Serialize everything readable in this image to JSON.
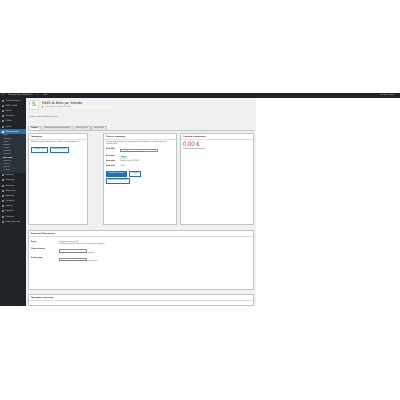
{
  "adminbar": {
    "site": "Ελληνικό Site με WordPress",
    "comments": "0",
    "new": "+ Νέο",
    "greeting": "Γεια σου, admin"
  },
  "sidebar": {
    "items": [
      {
        "label": "Πίνακας Ελέγχου"
      },
      {
        "label": "SMS Σε Web"
      },
      {
        "label": "Άρθρα"
      },
      {
        "label": "Πολυμέσα"
      },
      {
        "label": "Σελίδες"
      },
      {
        "label": "Σχόλια"
      },
      {
        "label": "WooCommerce",
        "active": true
      }
    ],
    "subitems": [
      "Αρχική",
      "Παραγγελίες",
      "Πελάτες",
      "Αναφορές",
      "Ρυθμίσεις",
      "Κατάσταση",
      "Επεκτάσεις",
      "SMS Σε Web",
      "Μάρκετινγκ",
      "Ρυθμίσεις",
      "Προϊόντα",
      "Ρυθμίσεις"
    ],
    "items2": [
      {
        "label": "Προϊόντα"
      },
      {
        "label": "Πληρωμές"
      },
      {
        "label": "Αναλυτικά"
      },
      {
        "label": "Μάρκετινγκ"
      },
      {
        "label": "Εμφάνιση"
      },
      {
        "label": "Πρόσθετα"
      },
      {
        "label": "Χρήστες"
      },
      {
        "label": "Εργαλεία"
      },
      {
        "label": "Ρυθμίσεις"
      },
      {
        "label": "Σύμπτυξη μενού"
      }
    ]
  },
  "header": {
    "logo_letter": "S",
    "title": "SMS Α-Μου με Yuboto",
    "notice": "Η σύνδεση με το Yuboto είναι ενεργή",
    "subtitle": "Ρυθμίσεις αποστολής SMS μέσω Yuboto"
  },
  "tabs": [
    {
      "label": "Ρυθμίσεις",
      "active": true
    },
    {
      "label": "Αποστολή μηνυμάτων παραγγελίας"
    },
    {
      "label": "Αποστολή SMS"
    },
    {
      "label": "Ιστορικό SMS"
    }
  ],
  "card_intro": {
    "title": "Παραμετροι",
    "text": "Ελέγξτε τα στοιχεία σύνδεσης και το υπόλοιπο του λογαριασμού σας.",
    "btn1": "Σύνδεση Yuboto",
    "btn2": "Ιστορικό χρεώσεων"
  },
  "card_account": {
    "title": "Ρόλο της εφαρμογής",
    "text": "Συμπληρώστε τα στοιχεία του λογαριασμού σας στο Yuboto για να ενεργοποιήσετε την αποστολή SMS.",
    "key_label": "Κλειδί (API)",
    "key_value": "••••••••••••••••",
    "key_desc": "Το κλειδί API του λογαριασμού Yuboto.",
    "status_label": "Κατάσταση",
    "status_value": "Ενεργό",
    "date_label": "Ημερομηνία",
    "date_value": "Συνδέθηκε στις 12/10/2023",
    "sender_label": "Αποστολέας",
    "sender_value": "Yuboto",
    "btn_primary": "Αποθήκευση αλλαγών",
    "btn_secondary": "Έλεγχος",
    "btn_link": "Αποσύνδεση λογαριασμού"
  },
  "card_balance": {
    "title": "Υπόλοιπο λογαριασμού",
    "amount": "0,00 €",
    "desc": "Φόρτωση πιστωτικών μονάδων"
  },
  "settings": {
    "title": "Αποστολή Ειδοποιήσεων",
    "rows": [
      {
        "label": "Ενεργό",
        "desc1": "Ενεργοποίηση αποστολής SMS",
        "desc2": "Τα SMS θα αποστέλλονται αυτόματα με την ολοκλήρωση της παραγγελίας."
      },
      {
        "label": "Όνομα αποστολέα",
        "value": "Yuboto",
        "desc1": "Το όνομα αποστολέα που θα εμφανίζεται στον παραλήπτη."
      },
      {
        "label": "Κωδικός χώρας",
        "value": "+30",
        "desc1": "Προεπιλεγμένος κωδικός χώρας για τους αριθμούς τηλεφώνου."
      }
    ]
  },
  "card_bottom": {
    "title": "Προτιμήσεις αποστολής"
  }
}
